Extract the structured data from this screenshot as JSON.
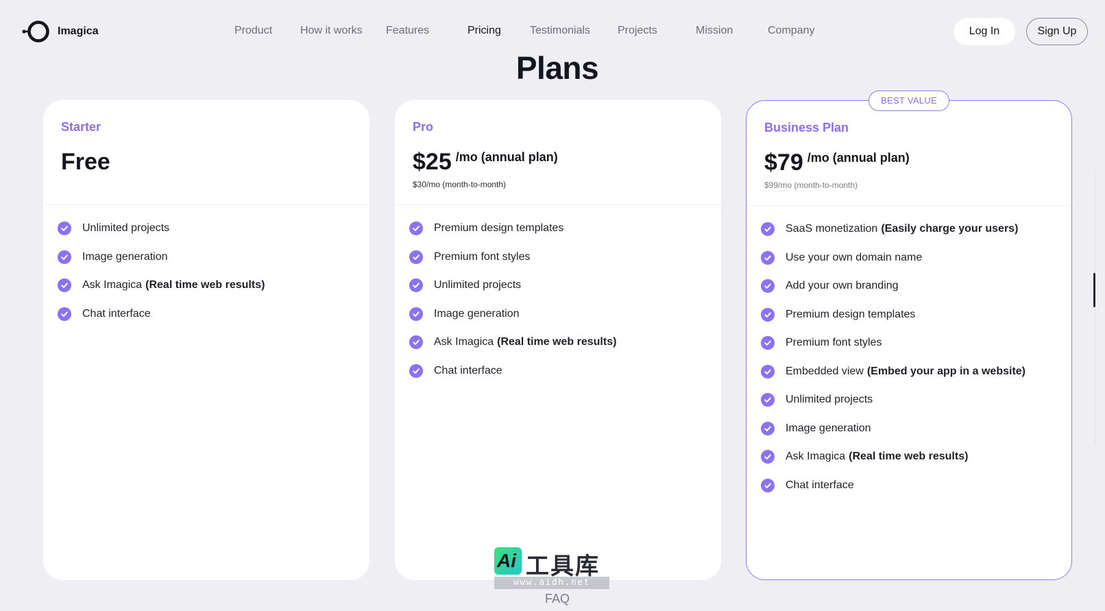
{
  "brand": {
    "name": "Imagica"
  },
  "nav": {
    "links": [
      "Product",
      "How it works",
      "Features",
      "Pricing",
      "Testimonials",
      "Projects",
      "Mission",
      "Company"
    ],
    "active": "Pricing",
    "login_label": "Log In",
    "signup_label": "Sign Up"
  },
  "page_title": "Plans",
  "plans": [
    {
      "name": "Starter",
      "price": "Free",
      "unit": "",
      "sub": "",
      "badge": "",
      "features": [
        {
          "text": "Unlimited projects",
          "bold": ""
        },
        {
          "text": "Image generation",
          "bold": ""
        },
        {
          "text": "Ask Imagica",
          "bold": "(Real time web results)"
        },
        {
          "text": "Chat interface",
          "bold": ""
        }
      ]
    },
    {
      "name": "Pro",
      "price": "$25",
      "unit": "/mo (annual plan)",
      "sub": "$30/mo (month-to-month)",
      "badge": "",
      "features": [
        {
          "text": "Premium design templates",
          "bold": ""
        },
        {
          "text": "Premium font styles",
          "bold": ""
        },
        {
          "text": "Unlimited projects",
          "bold": ""
        },
        {
          "text": "Image generation",
          "bold": ""
        },
        {
          "text": "Ask Imagica",
          "bold": "(Real time web results)"
        },
        {
          "text": "Chat interface",
          "bold": ""
        }
      ]
    },
    {
      "name": "Business Plan",
      "price": "$79",
      "unit": "/mo (annual plan)",
      "sub": "$99/mo (month-to-month)",
      "badge": "BEST VALUE",
      "features": [
        {
          "text": "SaaS monetization",
          "bold": "(Easily charge your users)"
        },
        {
          "text": "Use your own domain name",
          "bold": ""
        },
        {
          "text": "Add your own branding",
          "bold": ""
        },
        {
          "text": "Premium design templates",
          "bold": ""
        },
        {
          "text": "Premium font styles",
          "bold": ""
        },
        {
          "text": "Embedded view",
          "bold": "(Embed your app in a website)"
        },
        {
          "text": "Unlimited projects",
          "bold": ""
        },
        {
          "text": "Image generation",
          "bold": ""
        },
        {
          "text": "Ask Imagica",
          "bold": "(Real time web results)"
        },
        {
          "text": "Chat interface",
          "bold": ""
        }
      ]
    }
  ],
  "watermark": {
    "badge": "Ai",
    "text": "工具库",
    "url": "www.aidh.net"
  },
  "footer_link": "FAQ",
  "colors": {
    "accent": "#8b6cf2",
    "background": "#eeeef3",
    "card": "#ffffff",
    "text": "#15151d"
  },
  "icons": {
    "logo": "ring-logo-icon",
    "feature": "check-circle-icon"
  }
}
